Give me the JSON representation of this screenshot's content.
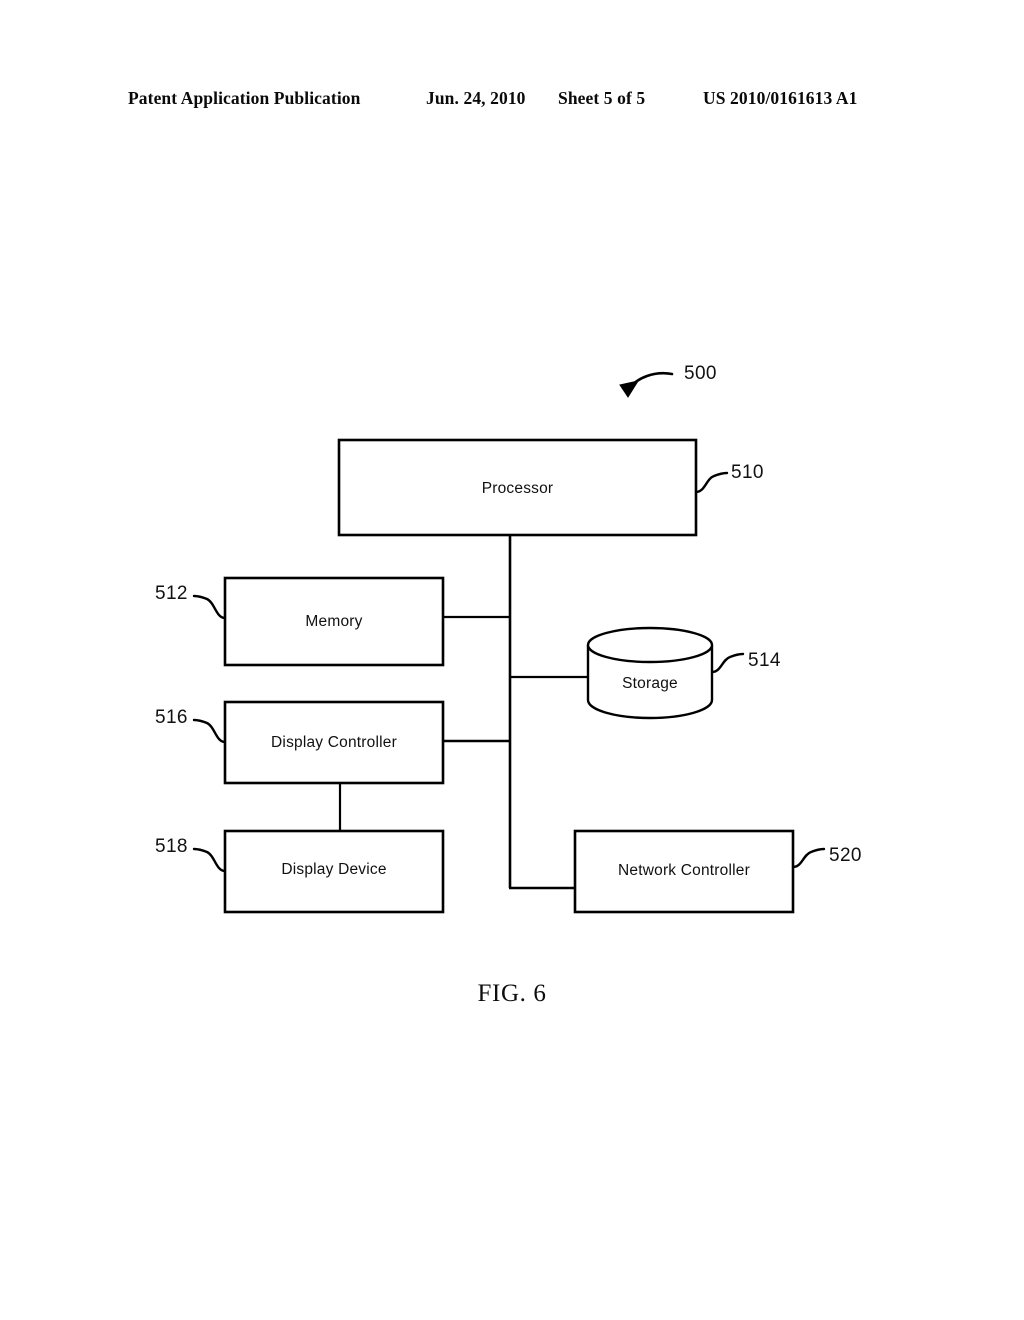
{
  "header": {
    "publication": "Patent Application Publication",
    "date": "Jun. 24, 2010",
    "sheet": "Sheet 5 of 5",
    "patent_number": "US 2010/0161613 A1"
  },
  "figure": {
    "caption": "FIG. 6",
    "system_ref": "500",
    "line_color": "#000000",
    "background": "#ffffff",
    "blocks": [
      {
        "id": "processor",
        "label": "Processor",
        "ref": "510",
        "shape": "rect",
        "ref_side": "right"
      },
      {
        "id": "memory",
        "label": "Memory",
        "ref": "512",
        "shape": "rect",
        "ref_side": "left"
      },
      {
        "id": "storage",
        "label": "Storage",
        "ref": "514",
        "shape": "cylinder",
        "ref_side": "right"
      },
      {
        "id": "display-controller",
        "label": "Display Controller",
        "ref": "516",
        "shape": "rect",
        "ref_side": "left"
      },
      {
        "id": "display-device",
        "label": "Display Device",
        "ref": "518",
        "shape": "rect",
        "ref_side": "left"
      },
      {
        "id": "network-controller",
        "label": "Network Controller",
        "ref": "520",
        "shape": "rect",
        "ref_side": "right"
      }
    ],
    "connections": [
      {
        "from": "processor",
        "to": "bus"
      },
      {
        "from": "memory",
        "to": "bus"
      },
      {
        "from": "bus",
        "to": "storage"
      },
      {
        "from": "display-controller",
        "to": "bus"
      },
      {
        "from": "display-controller",
        "to": "display-device"
      },
      {
        "from": "bus",
        "to": "network-controller"
      }
    ]
  }
}
